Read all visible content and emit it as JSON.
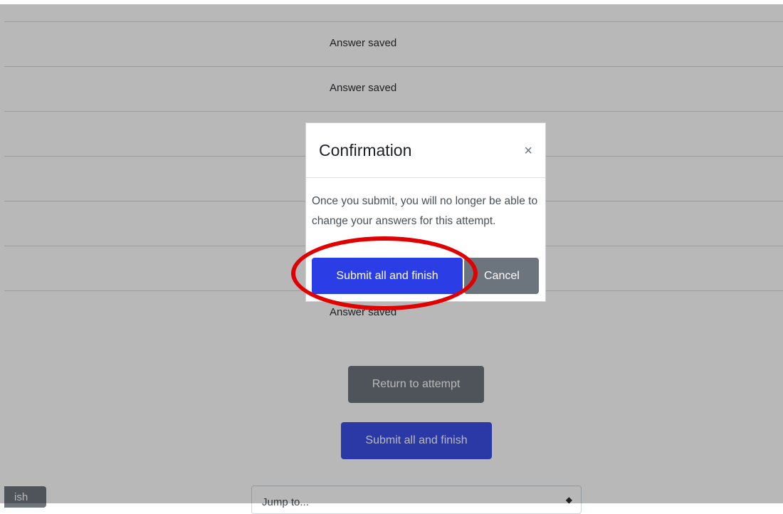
{
  "rows": [
    {
      "text": "Answer saved"
    },
    {
      "text": "Answer saved"
    },
    {
      "text": ""
    },
    {
      "text": ""
    },
    {
      "text": ""
    },
    {
      "text": ""
    },
    {
      "text": "Answer saved"
    }
  ],
  "actions": {
    "return_label": "Return to attempt",
    "submit_label": "Submit all and finish",
    "prev_label": "ish",
    "jump_placeholder": "Jump to..."
  },
  "modal": {
    "title": "Confirmation",
    "close_glyph": "×",
    "body": "Once you submit, you will no longer be able to change your answers for this attempt.",
    "submit_label": "Submit all and finish",
    "cancel_label": "Cancel"
  },
  "colors": {
    "primary": "#2b3ee6",
    "secondary": "#6c757d",
    "highlight": "#e00000"
  }
}
